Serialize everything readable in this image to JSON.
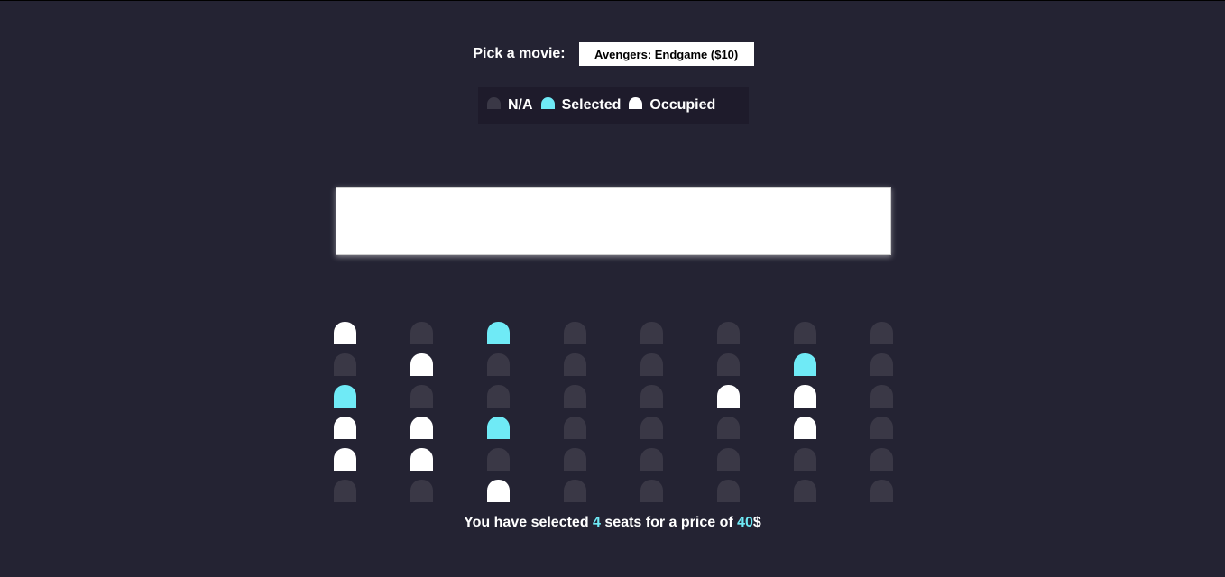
{
  "movie_picker": {
    "label": "Pick a movie:",
    "selected_value": "Avengers: Endgame ($10)"
  },
  "legend": {
    "items": [
      {
        "label": "N/A",
        "state": "na"
      },
      {
        "label": "Selected",
        "state": "selected"
      },
      {
        "label": "Occupied",
        "state": "occupied"
      }
    ]
  },
  "seats": [
    [
      "occupied",
      "na",
      "selected",
      "na",
      "na",
      "na",
      "na",
      "na"
    ],
    [
      "na",
      "occupied",
      "na",
      "na",
      "na",
      "na",
      "selected",
      "na"
    ],
    [
      "selected",
      "na",
      "na",
      "na",
      "na",
      "occupied",
      "occupied",
      "na"
    ],
    [
      "occupied",
      "occupied",
      "selected",
      "na",
      "na",
      "na",
      "occupied",
      "na"
    ],
    [
      "occupied",
      "occupied",
      "na",
      "na",
      "na",
      "na",
      "na",
      "na"
    ],
    [
      "na",
      "na",
      "occupied",
      "na",
      "na",
      "na",
      "na",
      "na"
    ]
  ],
  "summary": {
    "prefix": "You have selected ",
    "count": "4",
    "middle": " seats for a price of ",
    "price": "40",
    "suffix": "$"
  },
  "colors": {
    "background": "#242333",
    "seat_na": "#3a3846",
    "seat_selected": "#6feaf6",
    "seat_occupied": "#ffffff"
  }
}
